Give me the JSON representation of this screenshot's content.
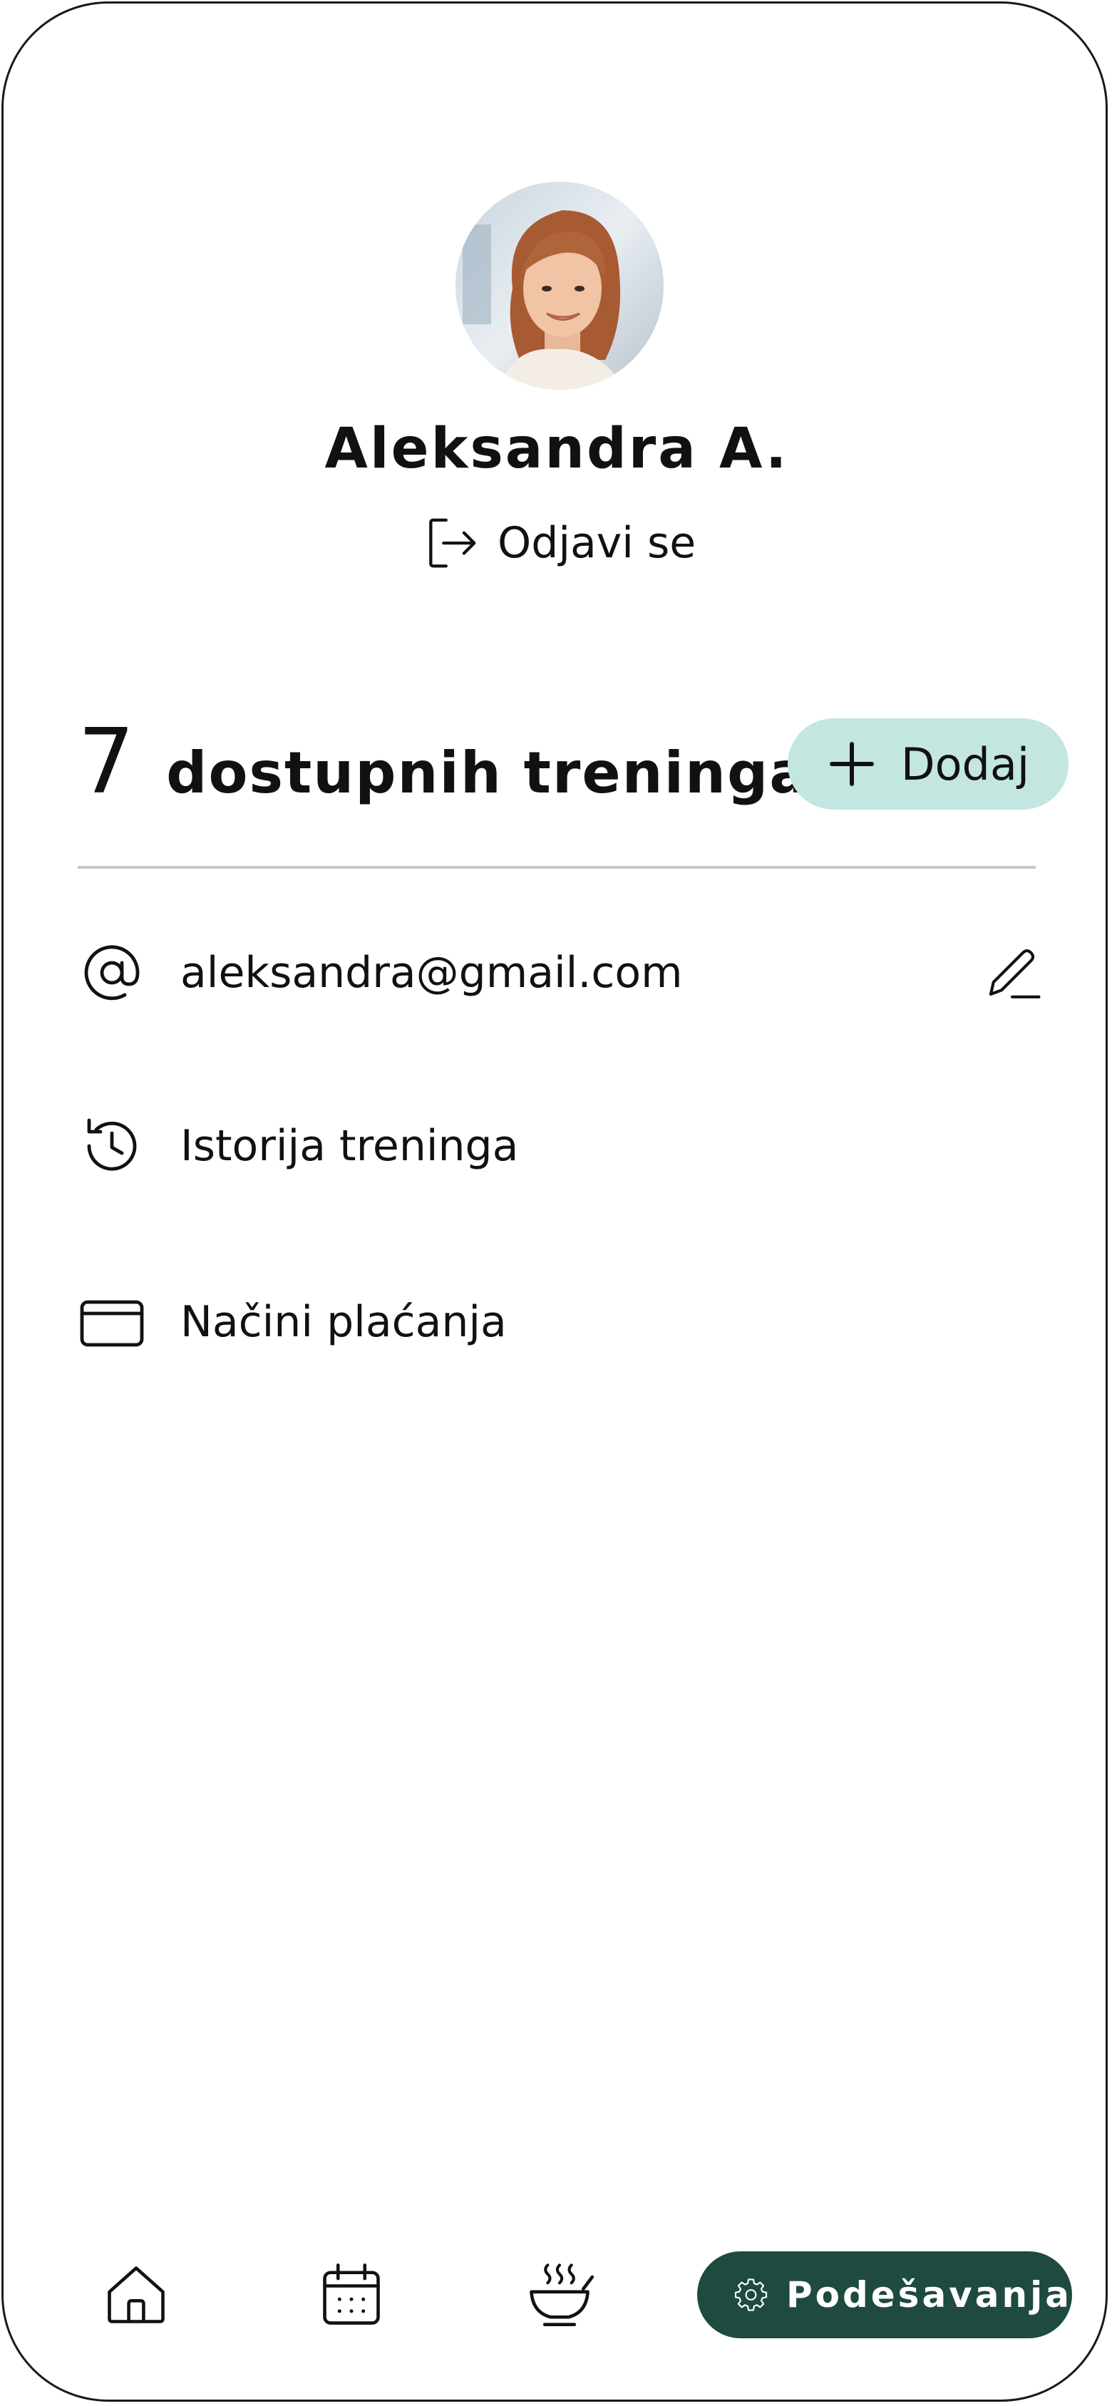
{
  "profile": {
    "name": "Aleksandra A.",
    "avatar_icon": "user-photo",
    "logout_label": "Odjavi se",
    "logout_icon": "logout-arrow-icon"
  },
  "trainings": {
    "count": "7",
    "label": "dostupnih treninga",
    "add_label": "Dodaj",
    "add_icon": "plus-icon"
  },
  "menu": {
    "email": {
      "value": "aleksandra@gmail.com",
      "icon": "at-sign-icon",
      "edit_icon": "pencil-icon"
    },
    "history": {
      "label": "Istorija treninga",
      "icon": "history-clock-icon"
    },
    "payment": {
      "label": "Načini plaćanja",
      "icon": "credit-card-icon"
    }
  },
  "bottom_nav": {
    "items": [
      {
        "icon": "home-icon"
      },
      {
        "icon": "calendar-icon"
      },
      {
        "icon": "food-bowl-icon"
      },
      {
        "icon": "gear-icon",
        "label": "Podešavanja",
        "active": true
      }
    ]
  },
  "colors": {
    "accent_light": "#c4e6e0",
    "accent_dark": "#1e4a40",
    "text": "#111111",
    "divider": "#c9c9c9"
  }
}
